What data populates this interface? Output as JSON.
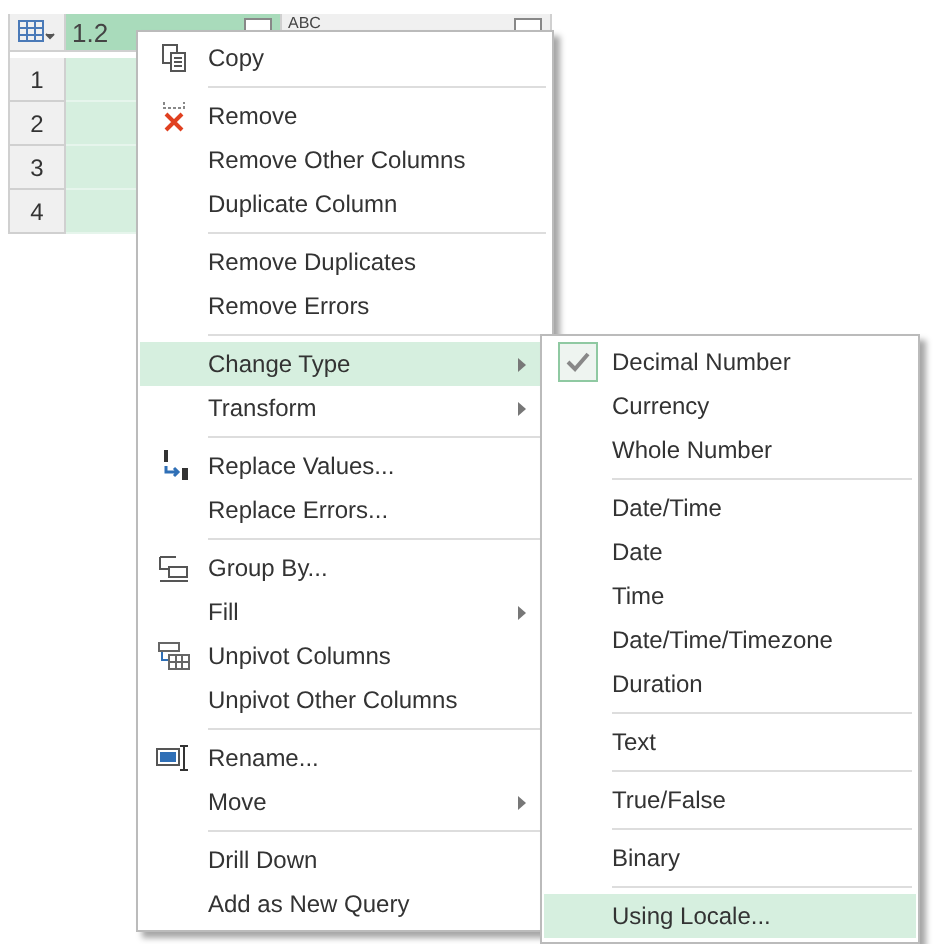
{
  "grid": {
    "columns": [
      {
        "type": "1.2",
        "selected": true
      },
      {
        "type": "ABC",
        "selected": false
      }
    ],
    "rows": [
      "1",
      "2",
      "3",
      "4"
    ]
  },
  "menu": {
    "groups": [
      [
        {
          "label": "Copy",
          "kind": "copy",
          "submenu": false,
          "selected": false
        }
      ],
      [
        {
          "label": "Remove",
          "kind": "remove",
          "submenu": false,
          "selected": false
        },
        {
          "label": "Remove Other Columns",
          "kind": "plain",
          "submenu": false,
          "selected": false
        },
        {
          "label": "Duplicate Column",
          "kind": "plain",
          "submenu": false,
          "selected": false
        }
      ],
      [
        {
          "label": "Remove Duplicates",
          "kind": "plain",
          "submenu": false,
          "selected": false
        },
        {
          "label": "Remove Errors",
          "kind": "plain",
          "submenu": false,
          "selected": false
        }
      ],
      [
        {
          "label": "Change Type",
          "kind": "plain",
          "submenu": true,
          "selected": true
        },
        {
          "label": "Transform",
          "kind": "plain",
          "submenu": true,
          "selected": false
        }
      ],
      [
        {
          "label": "Replace Values...",
          "kind": "replace",
          "submenu": false,
          "selected": false
        },
        {
          "label": "Replace Errors...",
          "kind": "plain",
          "submenu": false,
          "selected": false
        }
      ],
      [
        {
          "label": "Group By...",
          "kind": "group",
          "submenu": false,
          "selected": false
        },
        {
          "label": "Fill",
          "kind": "plain",
          "submenu": true,
          "selected": false
        },
        {
          "label": "Unpivot Columns",
          "kind": "unpivot",
          "submenu": false,
          "selected": false
        },
        {
          "label": "Unpivot Other Columns",
          "kind": "plain",
          "submenu": false,
          "selected": false
        }
      ],
      [
        {
          "label": "Rename...",
          "kind": "rename",
          "submenu": false,
          "selected": false
        },
        {
          "label": "Move",
          "kind": "plain",
          "submenu": true,
          "selected": false
        }
      ],
      [
        {
          "label": "Drill Down",
          "kind": "plain",
          "submenu": false,
          "selected": false
        },
        {
          "label": "Add as New Query",
          "kind": "plain",
          "submenu": false,
          "selected": false
        }
      ]
    ]
  },
  "submenu": {
    "groups": [
      [
        {
          "label": "Decimal Number",
          "checked": true,
          "selected": false
        },
        {
          "label": "Currency",
          "checked": false,
          "selected": false
        },
        {
          "label": "Whole Number",
          "checked": false,
          "selected": false
        }
      ],
      [
        {
          "label": "Date/Time",
          "checked": false,
          "selected": false
        },
        {
          "label": "Date",
          "checked": false,
          "selected": false
        },
        {
          "label": "Time",
          "checked": false,
          "selected": false
        },
        {
          "label": "Date/Time/Timezone",
          "checked": false,
          "selected": false
        },
        {
          "label": "Duration",
          "checked": false,
          "selected": false
        }
      ],
      [
        {
          "label": "Text",
          "checked": false,
          "selected": false
        }
      ],
      [
        {
          "label": "True/False",
          "checked": false,
          "selected": false
        }
      ],
      [
        {
          "label": "Binary",
          "checked": false,
          "selected": false
        }
      ],
      [
        {
          "label": "Using Locale...",
          "checked": false,
          "selected": true
        }
      ]
    ]
  }
}
